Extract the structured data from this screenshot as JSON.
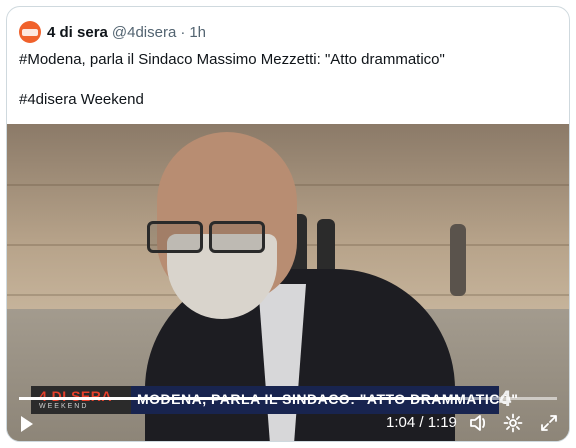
{
  "tweet": {
    "author_name": "4 di sera",
    "handle": "@4disera",
    "separator": "·",
    "time": "1h",
    "text_line1": "#Modena, parla il Sindaco Massimo Mezzetti: \"Atto drammatico\"",
    "text_line2": "#4disera Weekend"
  },
  "video": {
    "banner_logo_top": "4 DI SERA",
    "banner_logo_bottom": "WEEKEND",
    "banner_text": "MODENA, PARLA IL SINDACO: \"ATTO DRAMMATICO\"",
    "channel_logo": "4",
    "progress_fraction": 0.82,
    "timecode": "1:04 / 1:19"
  },
  "colors": {
    "accent": "#f0612b",
    "banner": "#18244f"
  },
  "icons": [
    "play-icon",
    "volume-icon",
    "settings-icon",
    "fullscreen-icon"
  ]
}
